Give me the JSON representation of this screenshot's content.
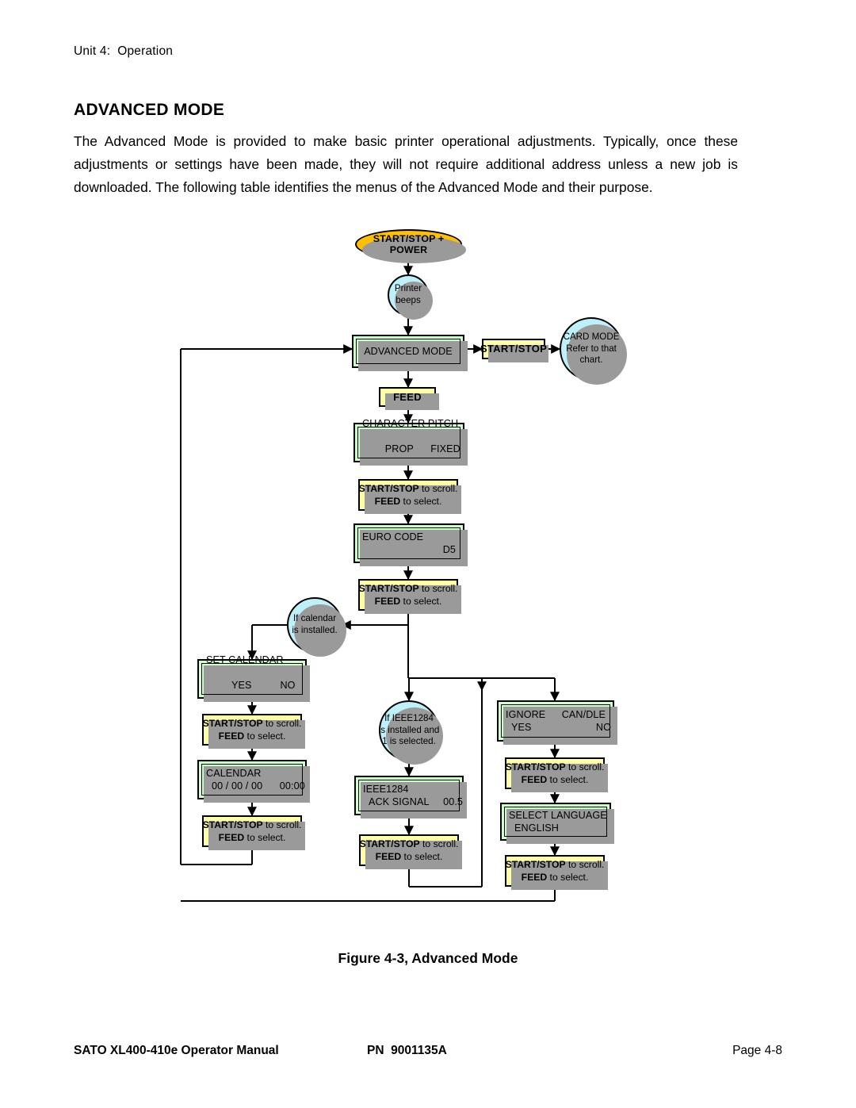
{
  "running_head": "Unit 4:  Operation",
  "page_title": "ADVANCED MODE",
  "intro": "The Advanced Mode is provided to make basic printer operational adjustments. Typically, once these adjustments or settings have been made, they will not require additional address unless a new job is downloaded. The following table identifies the menus of the Advanced Mode and their purpose.",
  "figure_caption": "Figure 4-3, Advanced Mode",
  "footer": {
    "manual": "SATO XL400-410e Operator Manual",
    "part_number": "PN  9001135A",
    "page": "Page 4-8"
  },
  "colors": {
    "lcd_green": "#CDFFCD",
    "key_yellow": "#FFFFA8",
    "start_orange": "#FFC000",
    "condition_blue": "#BDF0F8",
    "shadow_gray": "#9A9A9A",
    "outline_black": "#000000"
  },
  "chart_data": {
    "type": "diagram",
    "title": "Figure 4-3, Advanced Mode",
    "diagram_kind": "flowchart",
    "nodes": [
      {
        "id": "start",
        "kind": "terminator",
        "shape": "ellipse",
        "color": "#FFC000",
        "lines": [
          "START/STOP + POWER"
        ]
      },
      {
        "id": "printer-beeps",
        "kind": "condition",
        "shape": "circle",
        "color": "#BDF0F8",
        "lines": [
          "Printer",
          "beeps"
        ]
      },
      {
        "id": "advanced-mode",
        "kind": "display",
        "shape": "lcd",
        "color": "#CDFFCD",
        "lines": [
          "ADVANCED MODE"
        ]
      },
      {
        "id": "start-stop-key",
        "kind": "keypress",
        "shape": "key",
        "color": "#FFFFA8",
        "lines": [
          "START/STOP"
        ]
      },
      {
        "id": "card-mode",
        "kind": "condition",
        "shape": "circle",
        "color": "#BDF0F8",
        "lines": [
          "CARD MODE",
          "Refer to that",
          "chart."
        ]
      },
      {
        "id": "feed-key",
        "kind": "keypress",
        "shape": "key",
        "color": "#FFFFA8",
        "lines": [
          "FEED"
        ]
      },
      {
        "id": "character-pitch",
        "kind": "display",
        "shape": "lcd",
        "color": "#CDFFCD",
        "lines": [
          "CHARACTER PITCH",
          "PROP      FIXED"
        ]
      },
      {
        "id": "hint-1",
        "kind": "keypress",
        "shape": "key",
        "color": "#FFFFA8",
        "lines": [
          "START/STOP to scroll.",
          "FEED to select."
        ]
      },
      {
        "id": "euro-code",
        "kind": "display",
        "shape": "lcd",
        "color": "#CDFFCD",
        "lines": [
          "EURO CODE",
          "D5"
        ]
      },
      {
        "id": "hint-2",
        "kind": "keypress",
        "shape": "key",
        "color": "#FFFFA8",
        "lines": [
          "START/STOP to scroll.",
          "FEED to select."
        ]
      },
      {
        "id": "if-calendar",
        "kind": "condition",
        "shape": "circle",
        "color": "#BDF0F8",
        "lines": [
          "If calendar",
          "is installed."
        ]
      },
      {
        "id": "set-calendar",
        "kind": "display",
        "shape": "lcd",
        "color": "#CDFFCD",
        "lines": [
          "SET CALENDAR",
          "YES           NO"
        ]
      },
      {
        "id": "hint-3",
        "kind": "keypress",
        "shape": "key",
        "color": "#FFFFA8",
        "lines": [
          "START/STOP to scroll.",
          "FEED to select."
        ]
      },
      {
        "id": "calendar",
        "kind": "display",
        "shape": "lcd",
        "color": "#CDFFCD",
        "lines": [
          "CALENDAR",
          "00 / 00 / 00      00:00"
        ]
      },
      {
        "id": "hint-4",
        "kind": "keypress",
        "shape": "key",
        "color": "#FFFFA8",
        "lines": [
          "START/STOP to scroll.",
          "FEED to select."
        ]
      },
      {
        "id": "if-ieee1284",
        "kind": "condition",
        "shape": "circle",
        "color": "#BDF0F8",
        "lines": [
          "If IEEE1284",
          "is installed and",
          "1 is selected."
        ]
      },
      {
        "id": "ieee1284",
        "kind": "display",
        "shape": "lcd",
        "color": "#CDFFCD",
        "lines": [
          "IEEE1284",
          "ACK SIGNAL     00.5"
        ]
      },
      {
        "id": "hint-5",
        "kind": "keypress",
        "shape": "key",
        "color": "#FFFFA8",
        "lines": [
          "START/STOP to scroll.",
          "FEED to select."
        ]
      },
      {
        "id": "ignore-candle",
        "kind": "display",
        "shape": "lcd",
        "color": "#CDFFCD",
        "lines": [
          "IGNORE          CAN/DLE",
          "YES                NO"
        ]
      },
      {
        "id": "hint-6",
        "kind": "keypress",
        "shape": "key",
        "color": "#FFFFA8",
        "lines": [
          "START/STOP to scroll.",
          "FEED to select."
        ]
      },
      {
        "id": "select-language",
        "kind": "display",
        "shape": "lcd",
        "color": "#CDFFCD",
        "lines": [
          "SELECT LANGUAGE",
          "ENGLISH"
        ]
      },
      {
        "id": "hint-7",
        "kind": "keypress",
        "shape": "key",
        "color": "#FFFFA8",
        "lines": [
          "START/STOP to scroll.",
          "FEED to select."
        ]
      }
    ],
    "edges": [
      {
        "from": "start",
        "to": "printer-beeps"
      },
      {
        "from": "printer-beeps",
        "to": "advanced-mode"
      },
      {
        "from": "advanced-mode",
        "to": "start-stop-key"
      },
      {
        "from": "start-stop-key",
        "to": "card-mode"
      },
      {
        "from": "advanced-mode",
        "to": "feed-key"
      },
      {
        "from": "feed-key",
        "to": "character-pitch"
      },
      {
        "from": "character-pitch",
        "to": "hint-1"
      },
      {
        "from": "hint-1",
        "to": "euro-code"
      },
      {
        "from": "euro-code",
        "to": "hint-2"
      },
      {
        "from": "hint-2",
        "to": "if-calendar"
      },
      {
        "from": "if-calendar",
        "to": "set-calendar"
      },
      {
        "from": "set-calendar",
        "to": "hint-3"
      },
      {
        "from": "hint-3",
        "to": "calendar"
      },
      {
        "from": "calendar",
        "to": "hint-4"
      },
      {
        "from": "hint-4",
        "to": "advanced-mode",
        "note": "return loop via far left"
      },
      {
        "from": "hint-2",
        "to": "if-ieee1284"
      },
      {
        "from": "if-ieee1284",
        "to": "ieee1284"
      },
      {
        "from": "ieee1284",
        "to": "hint-5"
      },
      {
        "from": "hint-5",
        "to": "advanced-mode",
        "note": "return loop via bottom and far left"
      },
      {
        "from": "hint-2",
        "to": "ignore-candle"
      },
      {
        "from": "ignore-candle",
        "to": "hint-6"
      },
      {
        "from": "hint-6",
        "to": "select-language"
      },
      {
        "from": "select-language",
        "to": "hint-7"
      },
      {
        "from": "hint-7",
        "to": "advanced-mode",
        "note": "return loop via bottom and far left"
      }
    ]
  },
  "labels": {
    "start": "START/STOP + POWER",
    "printer_beeps_1": "Printer",
    "printer_beeps_2": "beeps",
    "advanced_mode": "ADVANCED MODE",
    "start_stop_key": "START/STOP",
    "card_mode_1": "CARD MODE",
    "card_mode_2": "Refer to that",
    "card_mode_3": "chart.",
    "feed_key": "FEED",
    "character_pitch_1": "CHARACTER PITCH",
    "character_pitch_prop": "PROP",
    "character_pitch_fixed": "FIXED",
    "euro_code_1": "EURO CODE",
    "euro_code_value": "D5",
    "if_calendar_1": "If calendar",
    "if_calendar_2": "is installed.",
    "set_calendar_1": "SET CALENDAR",
    "set_calendar_yes": "YES",
    "set_calendar_no": "NO",
    "calendar_1": "CALENDAR",
    "calendar_2": "00 / 00 / 00      00:00",
    "if_ieee_1": "If IEEE1284",
    "if_ieee_2": "is installed and",
    "if_ieee_3": "1 is selected.",
    "ieee_1": "IEEE1284",
    "ieee_2": "ACK SIGNAL     00.5",
    "ignore_label": "IGNORE",
    "candle_label": "CAN/DLE",
    "ignore_yes": "YES",
    "ignore_no": "NO",
    "select_language_1": "SELECT LANGUAGE",
    "select_language_2": "ENGLISH",
    "hint_bold_1": "START/STOP",
    "hint_rest_1": " to scroll.",
    "hint_bold_2": "FEED",
    "hint_rest_2": " to select."
  }
}
